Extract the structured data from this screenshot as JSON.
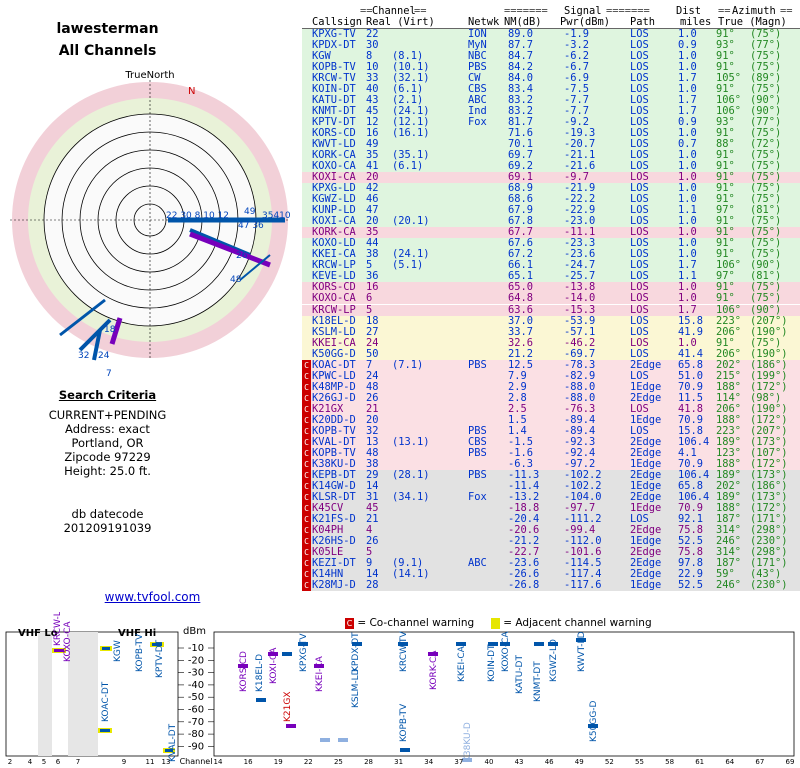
{
  "header": {
    "username": "lawesterman",
    "subtitle": "All Channels"
  },
  "polar": {
    "compass_label": "TrueNorth",
    "north_label": "N"
  },
  "criteria": {
    "heading": "Search Criteria",
    "lines": [
      "CURRENT+PENDING",
      "Address: exact",
      "Portland, OR",
      "Zipcode 97229",
      "Height: 25.0 ft."
    ]
  },
  "db": {
    "label": "db datecode",
    "value": "201209191039"
  },
  "link": {
    "text": "www.tvfool.com"
  },
  "table": {
    "group_headers": {
      "channel": "Channel",
      "signal": "Signal",
      "azimuth": "Azimuth"
    },
    "columns": {
      "callsign": "Callsign",
      "real_virt": "Real (Virt)",
      "network": "Netwk",
      "nm": "NM(dB)",
      "pwr": "Pwr(dBm)",
      "path": "Path",
      "dist_top": "Dist",
      "dist": "miles",
      "azimuth": "True (Magn)"
    },
    "rows": [
      {
        "callsign": "KPXG-TV",
        "real": "22",
        "virt": "",
        "net": "ION",
        "nm": "89.0",
        "pwr": "-1.9",
        "path": "LOS",
        "dist": "1.0",
        "az": "91°",
        "magn": "(75°)",
        "band": "g",
        "cc": false
      },
      {
        "callsign": "KPDX-DT",
        "real": "30",
        "virt": "",
        "net": "MyN",
        "nm": "87.7",
        "pwr": "-3.2",
        "path": "LOS",
        "dist": "0.9",
        "az": "93°",
        "magn": "(77°)",
        "band": "g",
        "cc": false
      },
      {
        "callsign": "KGW",
        "real": "8",
        "virt": "(8.1)",
        "net": "NBC",
        "nm": "84.7",
        "pwr": "-6.2",
        "path": "LOS",
        "dist": "1.0",
        "az": "91°",
        "magn": "(75°)",
        "band": "g",
        "cc": false
      },
      {
        "callsign": "KOPB-TV",
        "real": "10",
        "virt": "(10.1)",
        "net": "PBS",
        "nm": "84.2",
        "pwr": "-6.7",
        "path": "LOS",
        "dist": "1.0",
        "az": "91°",
        "magn": "(75°)",
        "band": "g",
        "cc": false
      },
      {
        "callsign": "KRCW-TV",
        "real": "33",
        "virt": "(32.1)",
        "net": "CW",
        "nm": "84.0",
        "pwr": "-6.9",
        "path": "LOS",
        "dist": "1.7",
        "az": "105°",
        "magn": "(89°)",
        "band": "g",
        "cc": false
      },
      {
        "callsign": "KOIN-DT",
        "real": "40",
        "virt": "(6.1)",
        "net": "CBS",
        "nm": "83.4",
        "pwr": "-7.5",
        "path": "LOS",
        "dist": "1.0",
        "az": "91°",
        "magn": "(75°)",
        "band": "g",
        "cc": false
      },
      {
        "callsign": "KATU-DT",
        "real": "43",
        "virt": "(2.1)",
        "net": "ABC",
        "nm": "83.2",
        "pwr": "-7.7",
        "path": "LOS",
        "dist": "1.7",
        "az": "106°",
        "magn": "(90°)",
        "band": "g",
        "cc": false
      },
      {
        "callsign": "KNMT-DT",
        "real": "45",
        "virt": "(24.1)",
        "net": "Ind",
        "nm": "83.2",
        "pwr": "-7.7",
        "path": "LOS",
        "dist": "1.7",
        "az": "106°",
        "magn": "(90°)",
        "band": "g",
        "cc": false
      },
      {
        "callsign": "KPTV-DT",
        "real": "12",
        "virt": "(12.1)",
        "net": "Fox",
        "nm": "81.7",
        "pwr": "-9.2",
        "path": "LOS",
        "dist": "0.9",
        "az": "93°",
        "magn": "(77°)",
        "band": "g",
        "cc": false
      },
      {
        "callsign": "KORS-CD",
        "real": "16",
        "virt": "(16.1)",
        "net": "",
        "nm": "71.6",
        "pwr": "-19.3",
        "path": "LOS",
        "dist": "1.0",
        "az": "91°",
        "magn": "(75°)",
        "band": "g",
        "cc": false
      },
      {
        "callsign": "KWVT-LD",
        "real": "49",
        "virt": "",
        "net": "",
        "nm": "70.1",
        "pwr": "-20.7",
        "path": "LOS",
        "dist": "0.7",
        "az": "88°",
        "magn": "(72°)",
        "band": "g",
        "cc": false
      },
      {
        "callsign": "KORK-CA",
        "real": "35",
        "virt": "(35.1)",
        "net": "",
        "nm": "69.7",
        "pwr": "-21.1",
        "path": "LOS",
        "dist": "1.0",
        "az": "91°",
        "magn": "(75°)",
        "band": "g",
        "cc": false
      },
      {
        "callsign": "KOXO-CA",
        "real": "41",
        "virt": "(6.1)",
        "net": "",
        "nm": "69.2",
        "pwr": "-21.6",
        "path": "LOS",
        "dist": "1.0",
        "az": "91°",
        "magn": "(75°)",
        "band": "g",
        "cc": false
      },
      {
        "callsign": "KOXI-CA",
        "real": "20",
        "virt": "",
        "net": "",
        "nm": "69.1",
        "pwr": "-9.7",
        "path": "LOS",
        "dist": "1.0",
        "az": "91°",
        "magn": "(75°)",
        "band": "p",
        "cc": false
      },
      {
        "callsign": "KPXG-LD",
        "real": "42",
        "virt": "",
        "net": "",
        "nm": "68.9",
        "pwr": "-21.9",
        "path": "LOS",
        "dist": "1.0",
        "az": "91°",
        "magn": "(75°)",
        "band": "g",
        "cc": false
      },
      {
        "callsign": "KGWZ-LD",
        "real": "46",
        "virt": "",
        "net": "",
        "nm": "68.6",
        "pwr": "-22.2",
        "path": "LOS",
        "dist": "1.0",
        "az": "91°",
        "magn": "(75°)",
        "band": "g",
        "cc": false
      },
      {
        "callsign": "KUNP-LD",
        "real": "47",
        "virt": "",
        "net": "",
        "nm": "67.9",
        "pwr": "-22.9",
        "path": "LOS",
        "dist": "1.1",
        "az": "97°",
        "magn": "(81°)",
        "band": "g",
        "cc": false
      },
      {
        "callsign": "KOXI-CA",
        "real": "20",
        "virt": "(20.1)",
        "net": "",
        "nm": "67.8",
        "pwr": "-23.0",
        "path": "LOS",
        "dist": "1.0",
        "az": "91°",
        "magn": "(75°)",
        "band": "g",
        "cc": false
      },
      {
        "callsign": "KORK-CA",
        "real": "35",
        "virt": "",
        "net": "",
        "nm": "67.7",
        "pwr": "-11.1",
        "path": "LOS",
        "dist": "1.0",
        "az": "91°",
        "magn": "(75°)",
        "band": "p",
        "cc": false
      },
      {
        "callsign": "KOXO-LD",
        "real": "44",
        "virt": "",
        "net": "",
        "nm": "67.6",
        "pwr": "-23.3",
        "path": "LOS",
        "dist": "1.0",
        "az": "91°",
        "magn": "(75°)",
        "band": "g",
        "cc": false
      },
      {
        "callsign": "KKEI-CA",
        "real": "38",
        "virt": "(24.1)",
        "net": "",
        "nm": "67.2",
        "pwr": "-23.6",
        "path": "LOS",
        "dist": "1.0",
        "az": "91°",
        "magn": "(75°)",
        "band": "g",
        "cc": false
      },
      {
        "callsign": "KRCW-LP",
        "real": "5",
        "virt": "(5.1)",
        "net": "",
        "nm": "66.1",
        "pwr": "-24.7",
        "path": "LOS",
        "dist": "1.7",
        "az": "106°",
        "magn": "(90°)",
        "band": "g",
        "cc": false
      },
      {
        "callsign": "KEVE-LD",
        "real": "36",
        "virt": "",
        "net": "",
        "nm": "65.1",
        "pwr": "-25.7",
        "path": "LOS",
        "dist": "1.1",
        "az": "97°",
        "magn": "(81°)",
        "band": "g",
        "cc": false
      },
      {
        "callsign": "KORS-CD",
        "real": "16",
        "virt": "",
        "net": "",
        "nm": "65.0",
        "pwr": "-13.8",
        "path": "LOS",
        "dist": "1.0",
        "az": "91°",
        "magn": "(75°)",
        "band": "p",
        "cc": false
      },
      {
        "callsign": "KOXO-CA",
        "real": "6",
        "virt": "",
        "net": "",
        "nm": "64.8",
        "pwr": "-14.0",
        "path": "LOS",
        "dist": "1.0",
        "az": "91°",
        "magn": "(75°)",
        "band": "p",
        "cc": false
      },
      {
        "callsign": "KRCW-LP",
        "real": "5",
        "virt": "",
        "net": "",
        "nm": "63.6",
        "pwr": "-15.3",
        "path": "LOS",
        "dist": "1.7",
        "az": "106°",
        "magn": "(90°)",
        "band": "p",
        "cc": false
      },
      {
        "callsign": "K18EL-D",
        "real": "18",
        "virt": "",
        "net": "",
        "nm": "37.0",
        "pwr": "-53.9",
        "path": "LOS",
        "dist": "15.8",
        "az": "223°",
        "magn": "(207°)",
        "band": "y",
        "cc": false
      },
      {
        "callsign": "KSLM-LD",
        "real": "27",
        "virt": "",
        "net": "",
        "nm": "33.7",
        "pwr": "-57.1",
        "path": "LOS",
        "dist": "41.9",
        "az": "206°",
        "magn": "(190°)",
        "band": "y",
        "cc": false
      },
      {
        "callsign": "KKEI-CA",
        "real": "24",
        "virt": "",
        "net": "",
        "nm": "32.6",
        "pwr": "-46.2",
        "path": "LOS",
        "dist": "1.0",
        "az": "91°",
        "magn": "(75°)",
        "band": "yp",
        "cc": false
      },
      {
        "callsign": "K50GG-D",
        "real": "50",
        "virt": "",
        "net": "",
        "nm": "21.2",
        "pwr": "-69.7",
        "path": "LOS",
        "dist": "41.4",
        "az": "206°",
        "magn": "(190°)",
        "band": "y",
        "cc": false
      },
      {
        "callsign": "KOAC-DT",
        "real": "7",
        "virt": "(7.1)",
        "net": "PBS",
        "nm": "12.5",
        "pwr": "-78.3",
        "path": "2Edge",
        "dist": "65.8",
        "az": "202°",
        "magn": "(186°)",
        "band": "r",
        "cc": true
      },
      {
        "callsign": "KPWC-LD",
        "real": "24",
        "virt": "",
        "net": "",
        "nm": "7.9",
        "pwr": "-82.9",
        "path": "LOS",
        "dist": "51.0",
        "az": "215°",
        "magn": "(199°)",
        "band": "r",
        "cc": true
      },
      {
        "callsign": "K48MP-D",
        "real": "48",
        "virt": "",
        "net": "",
        "nm": "2.9",
        "pwr": "-88.0",
        "path": "1Edge",
        "dist": "70.9",
        "az": "188°",
        "magn": "(172°)",
        "band": "r",
        "cc": true
      },
      {
        "callsign": "K26GJ-D",
        "real": "26",
        "virt": "",
        "net": "",
        "nm": "2.8",
        "pwr": "-88.0",
        "path": "2Edge",
        "dist": "11.5",
        "az": "114°",
        "magn": "(98°)",
        "band": "r",
        "cc": true
      },
      {
        "callsign": "K21GX",
        "real": "21",
        "virt": "",
        "net": "",
        "nm": "2.5",
        "pwr": "-76.3",
        "path": "LOS",
        "dist": "41.8",
        "az": "206°",
        "magn": "(190°)",
        "band": "rp",
        "cc": true
      },
      {
        "callsign": "K20DD-D",
        "real": "20",
        "virt": "",
        "net": "",
        "nm": "1.5",
        "pwr": "-89.4",
        "path": "1Edge",
        "dist": "70.9",
        "az": "188°",
        "magn": "(172°)",
        "band": "r",
        "cc": true
      },
      {
        "callsign": "KOPB-TV",
        "real": "32",
        "virt": "",
        "net": "PBS",
        "nm": "1.4",
        "pwr": "-89.4",
        "path": "LOS",
        "dist": "15.8",
        "az": "223°",
        "magn": "(207°)",
        "band": "r",
        "cc": true
      },
      {
        "callsign": "KVAL-DT",
        "real": "13",
        "virt": "(13.1)",
        "net": "CBS",
        "nm": "-1.5",
        "pwr": "-92.3",
        "path": "2Edge",
        "dist": "106.4",
        "az": "189°",
        "magn": "(173°)",
        "band": "r",
        "cc": true
      },
      {
        "callsign": "KOPB-TV",
        "real": "48",
        "virt": "",
        "net": "PBS",
        "nm": "-1.6",
        "pwr": "-92.4",
        "path": "2Edge",
        "dist": "4.1",
        "az": "123°",
        "magn": "(107°)",
        "band": "r",
        "cc": true
      },
      {
        "callsign": "K38KU-D",
        "real": "38",
        "virt": "",
        "net": "",
        "nm": "-6.3",
        "pwr": "-97.2",
        "path": "1Edge",
        "dist": "70.9",
        "az": "188°",
        "magn": "(172°)",
        "band": "r",
        "cc": true
      },
      {
        "callsign": "KEPB-DT",
        "real": "29",
        "virt": "(28.1)",
        "net": "PBS",
        "nm": "-11.3",
        "pwr": "-102.2",
        "path": "2Edge",
        "dist": "106.4",
        "az": "189°",
        "magn": "(173°)",
        "band": "x",
        "cc": true
      },
      {
        "callsign": "K14GW-D",
        "real": "14",
        "virt": "",
        "net": "",
        "nm": "-11.4",
        "pwr": "-102.2",
        "path": "1Edge",
        "dist": "65.8",
        "az": "202°",
        "magn": "(186°)",
        "band": "x",
        "cc": true
      },
      {
        "callsign": "KLSR-DT",
        "real": "31",
        "virt": "(34.1)",
        "net": "Fox",
        "nm": "-13.2",
        "pwr": "-104.0",
        "path": "2Edge",
        "dist": "106.4",
        "az": "189°",
        "magn": "(173°)",
        "band": "x",
        "cc": true
      },
      {
        "callsign": "K45CV",
        "real": "45",
        "virt": "",
        "net": "",
        "nm": "-18.8",
        "pwr": "-97.7",
        "path": "1Edge",
        "dist": "70.9",
        "az": "188°",
        "magn": "(172°)",
        "band": "xp",
        "cc": true
      },
      {
        "callsign": "K21FS-D",
        "real": "21",
        "virt": "",
        "net": "",
        "nm": "-20.4",
        "pwr": "-111.2",
        "path": "LOS",
        "dist": "92.1",
        "az": "187°",
        "magn": "(171°)",
        "band": "x",
        "cc": true
      },
      {
        "callsign": "K04PH",
        "real": "4",
        "virt": "",
        "net": "",
        "nm": "-20.6",
        "pwr": "-99.4",
        "path": "2Edge",
        "dist": "75.8",
        "az": "314°",
        "magn": "(298°)",
        "band": "xp",
        "cc": true
      },
      {
        "callsign": "K26HS-D",
        "real": "26",
        "virt": "",
        "net": "",
        "nm": "-21.2",
        "pwr": "-112.0",
        "path": "1Edge",
        "dist": "52.5",
        "az": "246°",
        "magn": "(230°)",
        "band": "x",
        "cc": true
      },
      {
        "callsign": "K05LE",
        "real": "5",
        "virt": "",
        "net": "",
        "nm": "-22.7",
        "pwr": "-101.6",
        "path": "2Edge",
        "dist": "75.8",
        "az": "314°",
        "magn": "(298°)",
        "band": "xp",
        "cc": true
      },
      {
        "callsign": "KEZI-DT",
        "real": "9",
        "virt": "(9.1)",
        "net": "ABC",
        "nm": "-23.6",
        "pwr": "-114.5",
        "path": "2Edge",
        "dist": "97.8",
        "az": "187°",
        "magn": "(171°)",
        "band": "x",
        "cc": true
      },
      {
        "callsign": "K14HN",
        "real": "14",
        "virt": "(14.1)",
        "net": "",
        "nm": "-26.6",
        "pwr": "-117.4",
        "path": "2Edge",
        "dist": "22.9",
        "az": "59°",
        "magn": "(43°)",
        "band": "x",
        "cc": true
      },
      {
        "callsign": "K28MJ-D",
        "real": "28",
        "virt": "",
        "net": "",
        "nm": "-26.8",
        "pwr": "-117.6",
        "path": "1Edge",
        "dist": "52.5",
        "az": "246°",
        "magn": "(230°)",
        "band": "x",
        "cc": true
      }
    ]
  },
  "legend": {
    "cochannel": "= Co-channel warning",
    "adjacent": "= Adjacent channel warning"
  },
  "bottom": {
    "vhf_lo": "VHF Lo",
    "vhf_hi": "VHF Hi",
    "unit": "dBm",
    "channel_label": "Channel",
    "y_ticks": [
      "-10",
      "-20",
      "-30",
      "-40",
      "-50",
      "-60",
      "-70",
      "-80",
      "-90"
    ],
    "vhf_channels": [
      "2",
      "4",
      "5",
      "6",
      "7",
      "9",
      "11",
      "13"
    ],
    "uhf_channels": [
      "14",
      "16",
      "19",
      "22",
      "25",
      "28",
      "31",
      "34",
      "37",
      "40",
      "43",
      "46",
      "49",
      "52",
      "55",
      "58",
      "61",
      "64",
      "67",
      "69"
    ]
  },
  "colors": {
    "green": "#dff5df",
    "yellow": "#fbf7d4",
    "pink": "#fbe0e4",
    "gray": "#e2e2e2",
    "blue": "#0033cc",
    "purple": "#800080",
    "red_cc": "#cc0000"
  }
}
